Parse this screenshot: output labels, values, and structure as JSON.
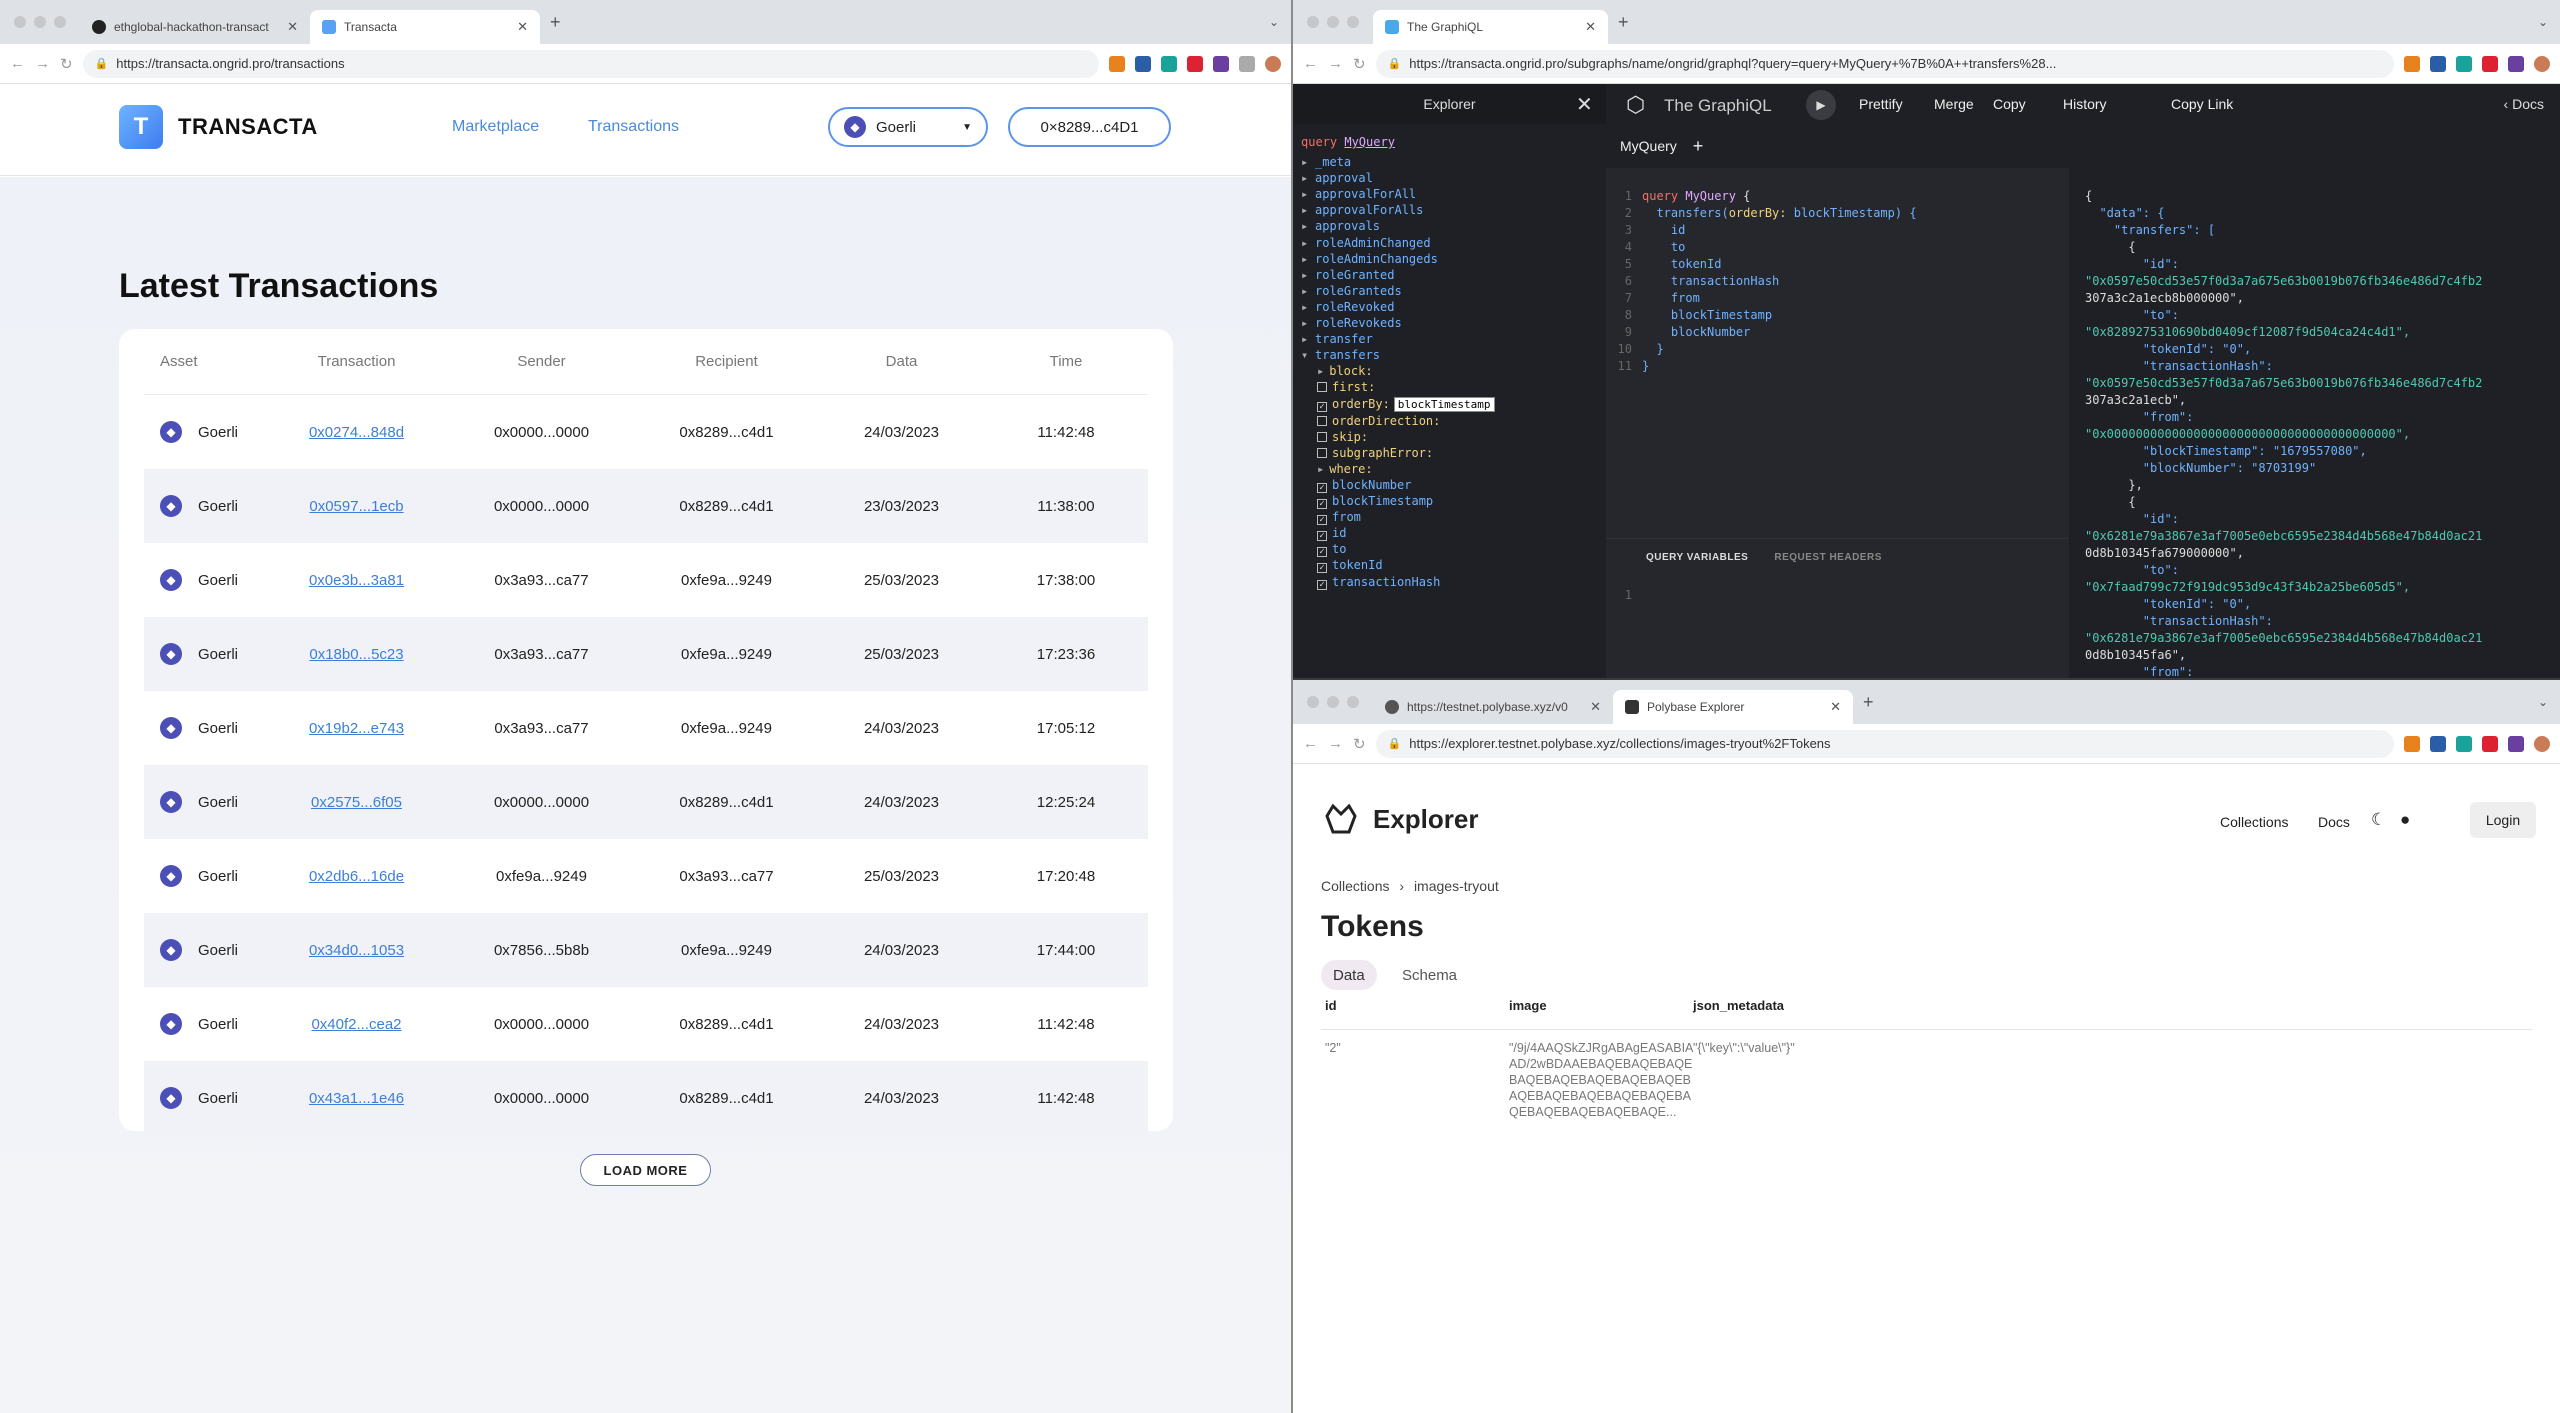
{
  "left_window": {
    "tabs": [
      {
        "label": "ethglobal-hackathon-transact",
        "icon": "github-icon"
      },
      {
        "label": "Transacta",
        "icon": "transacta-icon"
      }
    ],
    "url": "https://transacta.ongrid.pro/transactions",
    "app": {
      "brand": "TRANSACTA",
      "nav": [
        "Marketplace",
        "Transactions"
      ],
      "network": "Goerli",
      "wallet": "0×8289...c4D1",
      "title": "Latest Transactions",
      "columns": [
        "Asset",
        "Transaction",
        "Sender",
        "Recipient",
        "Data",
        "Time"
      ],
      "rows": [
        {
          "asset": "Goerli",
          "tx": "0x0274...848d",
          "sender": "0x0000...0000",
          "recipient": "0x8289...c4d1",
          "date": "24/03/2023",
          "time": "11:42:48"
        },
        {
          "asset": "Goerli",
          "tx": "0x0597...1ecb",
          "sender": "0x0000...0000",
          "recipient": "0x8289...c4d1",
          "date": "23/03/2023",
          "time": "11:38:00"
        },
        {
          "asset": "Goerli",
          "tx": "0x0e3b...3a81",
          "sender": "0x3a93...ca77",
          "recipient": "0xfe9a...9249",
          "date": "25/03/2023",
          "time": "17:38:00"
        },
        {
          "asset": "Goerli",
          "tx": "0x18b0...5c23",
          "sender": "0x3a93...ca77",
          "recipient": "0xfe9a...9249",
          "date": "25/03/2023",
          "time": "17:23:36"
        },
        {
          "asset": "Goerli",
          "tx": "0x19b2...e743",
          "sender": "0x3a93...ca77",
          "recipient": "0xfe9a...9249",
          "date": "24/03/2023",
          "time": "17:05:12"
        },
        {
          "asset": "Goerli",
          "tx": "0x2575...6f05",
          "sender": "0x0000...0000",
          "recipient": "0x8289...c4d1",
          "date": "24/03/2023",
          "time": "12:25:24"
        },
        {
          "asset": "Goerli",
          "tx": "0x2db6...16de",
          "sender": "0xfe9a...9249",
          "recipient": "0x3a93...ca77",
          "date": "25/03/2023",
          "time": "17:20:48"
        },
        {
          "asset": "Goerli",
          "tx": "0x34d0...1053",
          "sender": "0x7856...5b8b",
          "recipient": "0xfe9a...9249",
          "date": "24/03/2023",
          "time": "17:44:00"
        },
        {
          "asset": "Goerli",
          "tx": "0x40f2...cea2",
          "sender": "0x0000...0000",
          "recipient": "0x8289...c4d1",
          "date": "24/03/2023",
          "time": "11:42:48"
        },
        {
          "asset": "Goerli",
          "tx": "0x43a1...1e46",
          "sender": "0x0000...0000",
          "recipient": "0x8289...c4d1",
          "date": "24/03/2023",
          "time": "11:42:48"
        }
      ],
      "load_more": "LOAD MORE"
    }
  },
  "top_right_window": {
    "tab": "The GraphiQL",
    "url": "https://transacta.ongrid.pro/subgraphs/name/ongrid/graphql?query=query+MyQuery+%7B%0A++transfers%28...",
    "explorer_title": "Explorer",
    "app_title": "The GraphiQL",
    "toolbar": [
      "Prettify",
      "Merge",
      "Copy",
      "History",
      "Copy Link"
    ],
    "docs": "Docs",
    "query_tab": "MyQuery",
    "explorer_query_keyword": "query",
    "explorer_query_name": "MyQuery",
    "explorer_items": [
      "_meta",
      "approval",
      "approvalForAll",
      "approvalForAlls",
      "approvals",
      "roleAdminChanged",
      "roleAdminChangeds",
      "roleGranted",
      "roleGranteds",
      "roleRevoked",
      "roleRevokeds",
      "transfer",
      "transfers"
    ],
    "explorer_args": [
      {
        "label": "block:",
        "kind": "expand"
      },
      {
        "label": "first:",
        "kind": "check",
        "checked": false
      },
      {
        "label": "orderBy:",
        "kind": "check",
        "checked": true,
        "value": "blockTimestamp"
      },
      {
        "label": "orderDirection:",
        "kind": "check",
        "checked": false
      },
      {
        "label": "skip:",
        "kind": "check",
        "checked": false
      },
      {
        "label": "subgraphError:",
        "kind": "check",
        "checked": false
      },
      {
        "label": "where:",
        "kind": "expand"
      }
    ],
    "explorer_fields": [
      "blockNumber",
      "blockTimestamp",
      "from",
      "id",
      "to",
      "tokenId",
      "transactionHash"
    ],
    "query_lines": [
      [
        "query ",
        "MyQuery",
        " {"
      ],
      [
        "  transfers(",
        "orderBy:",
        " blockTimestamp) {"
      ],
      [
        "    id"
      ],
      [
        "    to"
      ],
      [
        "    tokenId"
      ],
      [
        "    transactionHash"
      ],
      [
        "    from"
      ],
      [
        "    blockTimestamp"
      ],
      [
        "    blockNumber"
      ],
      [
        "  }"
      ],
      [
        "}"
      ]
    ],
    "vars_tabs": [
      "QUERY VARIABLES",
      "REQUEST HEADERS"
    ],
    "result_lines": [
      "{",
      "  \"data\": {",
      "    \"transfers\": [",
      "      {",
      "        \"id\":",
      "\"0x0597e50cd53e57f0d3a7a675e63b0019b076fb346e486d7c4fb2",
      "307a3c2a1ecb8b000000\",",
      "        \"to\":",
      "\"0x8289275310690bd0409cf12087f9d504ca24c4d1\",",
      "        \"tokenId\": \"0\",",
      "        \"transactionHash\":",
      "\"0x0597e50cd53e57f0d3a7a675e63b0019b076fb346e486d7c4fb2",
      "307a3c2a1ecb\",",
      "        \"from\":",
      "\"0x0000000000000000000000000000000000000000\",",
      "        \"blockTimestamp\": \"1679557080\",",
      "        \"blockNumber\": \"8703199\"",
      "      },",
      "      {",
      "        \"id\":",
      "\"0x6281e79a3867e3af7005e0ebc6595e2384d4b568e47b84d0ac21",
      "0d8b10345fa679000000\",",
      "        \"to\":",
      "\"0x7faad799c72f919dc953d9c43f34b2a25be605d5\",",
      "        \"tokenId\": \"0\",",
      "        \"transactionHash\":",
      "\"0x6281e79a3867e3af7005e0ebc6595e2384d4b568e47b84d0ac21",
      "0d8b10345fa6\",",
      "        \"from\":"
    ]
  },
  "bottom_right_window": {
    "tabs": [
      {
        "label": "https://testnet.polybase.xyz/v0"
      },
      {
        "label": "Polybase Explorer"
      }
    ],
    "url": "https://explorer.testnet.polybase.xyz/collections/images-tryout%2FTokens",
    "brand": "Explorer",
    "nav": [
      "Collections",
      "Docs"
    ],
    "login": "Login",
    "breadcrumb": [
      "Collections",
      "images-tryout"
    ],
    "title": "Tokens",
    "tabs_inner": [
      "Data",
      "Schema"
    ],
    "columns": [
      "id",
      "image",
      "json_metadata"
    ],
    "row": {
      "id": "\"2\"",
      "image": "\"/9j/4AAQSkZJRgABAgEASABIAAD/2wBDAAEBAQEBAQEBAQEBAQEBAQEBAQEBAQEBAQEBAQEBAQEBAQEBAQEBAQEBAQEBAQEBAQEBAQEBAQE...",
      "json_metadata": "\"{\\\"key\\\":\\\"value\\\"}\""
    }
  },
  "colors": {
    "accent": "#4a8ad8",
    "eth": "#4b4fb6",
    "graphiql_bg": "#1e2025"
  }
}
